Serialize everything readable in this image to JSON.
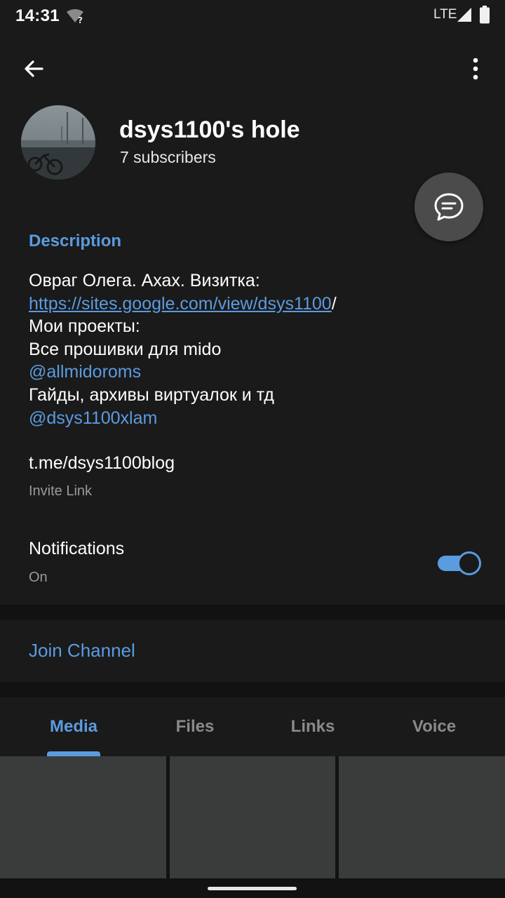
{
  "status_bar": {
    "time": "14:31",
    "network": "LTE",
    "icons": [
      "wifi-unknown-icon",
      "signal-icon",
      "battery-icon"
    ]
  },
  "toolbar": {
    "back_icon": "arrow-back-icon",
    "menu_icon": "more-vert-icon"
  },
  "channel": {
    "title": "dsys1100's hole",
    "subscribers": "7 subscribers",
    "avatar": "channel-avatar"
  },
  "fab_icon": "chat-bubble-icon",
  "description": {
    "header": "Description",
    "line1": "Овраг Олега. Ахах. Визитка:",
    "url": "https://sites.google.com/view/dsys1100",
    "url_suffix": "/",
    "line3": "Мои проекты:",
    "line4": "Все прошивки для mido",
    "mention1": "@allmidoroms",
    "line6": "Гайды, архивы виртуалок и тд",
    "mention2": "@dsys1100xlam"
  },
  "invite": {
    "link": "t.me/dsys1100blog",
    "label": "Invite Link"
  },
  "notifications": {
    "label": "Notifications",
    "status": "On",
    "enabled": true
  },
  "join": {
    "label": "Join Channel"
  },
  "tabs": [
    {
      "label": "Media",
      "active": true
    },
    {
      "label": "Files",
      "active": false
    },
    {
      "label": "Links",
      "active": false
    },
    {
      "label": "Voice",
      "active": false
    }
  ],
  "colors": {
    "accent": "#5b9be0",
    "background": "#1a1a1a",
    "divider": "#121212",
    "fab": "#4b4b4b",
    "media_cell": "#3a3c3c"
  }
}
